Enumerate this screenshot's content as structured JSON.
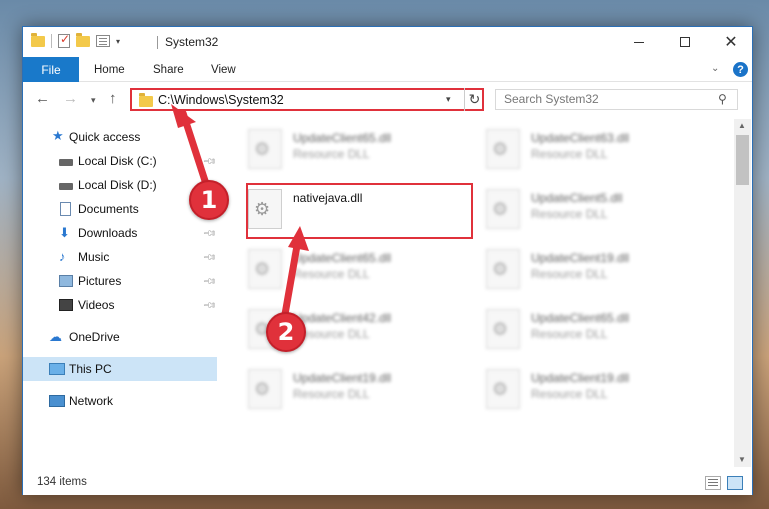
{
  "window": {
    "title": "System32",
    "buttons": {
      "minimize": "minimize",
      "maximize": "maximize",
      "close": "✕"
    }
  },
  "ribbon": {
    "tabs": {
      "file": "File",
      "home": "Home",
      "share": "Share",
      "view": "View"
    },
    "help": "?"
  },
  "address_bar": {
    "path": "C:\\Windows\\System32"
  },
  "search": {
    "placeholder": "Search System32"
  },
  "nav_pane": {
    "items": [
      {
        "label": "Quick access",
        "icon": "star-icon"
      },
      {
        "label": "Local Disk (C:)",
        "icon": "disk-icon",
        "pinned": true
      },
      {
        "label": "Local Disk (D:)",
        "icon": "disk-icon",
        "pinned": false
      },
      {
        "label": "Documents",
        "icon": "document-icon",
        "pinned": true
      },
      {
        "label": "Downloads",
        "icon": "download-icon",
        "pinned": true
      },
      {
        "label": "Music",
        "icon": "music-icon",
        "pinned": true
      },
      {
        "label": "Pictures",
        "icon": "pictures-icon",
        "pinned": true
      },
      {
        "label": "Videos",
        "icon": "videos-icon",
        "pinned": true
      },
      {
        "label": "OneDrive",
        "icon": "cloud-icon"
      },
      {
        "label": "This PC",
        "icon": "computer-icon",
        "selected": true
      },
      {
        "label": "Network",
        "icon": "network-icon"
      }
    ]
  },
  "files": [
    {
      "name": "UpdateClient65.dll",
      "type": "Resource DLL"
    },
    {
      "name": "UpdateClient63.dll",
      "type": "Resource DLL"
    },
    {
      "name": "nativejava.dll",
      "type": ""
    },
    {
      "name": "UpdateClient5.dll",
      "type": "Resource DLL"
    },
    {
      "name": "UpdateClient65.dll",
      "type": "Resource DLL"
    },
    {
      "name": "UpdateClient19.dll",
      "type": "Resource DLL"
    },
    {
      "name": "UpdateClient42.dll",
      "type": "Resource DLL"
    },
    {
      "name": "UpdateClient65.dll",
      "type": "Resource DLL"
    },
    {
      "name": "UpdateClient19.dll",
      "type": "Resource DLL"
    },
    {
      "name": "UpdateClient19.dll",
      "type": "Resource DLL"
    }
  ],
  "status_bar": {
    "item_count": "134 items"
  },
  "annotations": {
    "step1": "1",
    "step2": "2",
    "color": "#e0313b"
  },
  "colors": {
    "accent": "#1979ca",
    "selection": "#cce4f7"
  }
}
